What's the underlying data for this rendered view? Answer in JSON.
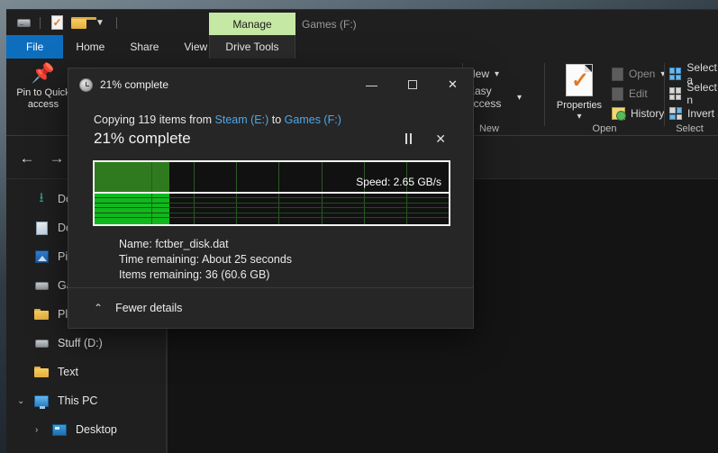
{
  "window": {
    "title": "Games (F:)",
    "contextual_tab": "Manage",
    "contextual_tab_color": "#c5e8a4"
  },
  "quick_access": {
    "items": [
      {
        "icon": "drive-icon",
        "name": "drive"
      },
      {
        "icon": "properties-icon",
        "name": "properties"
      },
      {
        "icon": "folder-icon",
        "name": "new-folder"
      },
      {
        "icon": "chevron-down-icon",
        "name": "customize"
      }
    ]
  },
  "tabs": [
    {
      "label": "File",
      "name": "tab-file",
      "active": false
    },
    {
      "label": "Home",
      "name": "tab-home",
      "active": true
    },
    {
      "label": "Share",
      "name": "tab-share",
      "active": false
    },
    {
      "label": "View",
      "name": "tab-view",
      "active": false
    },
    {
      "label": "Drive Tools",
      "name": "tab-drive-tools",
      "active": false
    }
  ],
  "ribbon": {
    "clipboard": {
      "pin_label": "Pin to Quick\naccess",
      "pin_label_line1": "Pin to Quick",
      "pin_label_line2": "access"
    },
    "groups": [
      {
        "label": "New",
        "name": "ribbon-group-new"
      },
      {
        "label": "Open",
        "name": "ribbon-group-open"
      },
      {
        "label": "Select",
        "name": "ribbon-group-select"
      }
    ],
    "new_group": {
      "new_label": "New",
      "easy_access_label": "Easy access"
    },
    "open_group": {
      "properties_label": "Properties",
      "open_label": "Open",
      "edit_label": "Edit",
      "history_label": "History"
    },
    "select_group": {
      "select_all_label": "Select a",
      "select_none_label": "Select n",
      "invert_label": "Invert s"
    }
  },
  "navigation": {
    "back": "←",
    "forward": "→"
  },
  "nav_pane": {
    "items": [
      {
        "label": "Dow",
        "icon": "downloads-icon",
        "name": "sidebar-item-downloads",
        "indent": 1,
        "chevron": ""
      },
      {
        "label": "Doc",
        "icon": "documents-icon",
        "name": "sidebar-item-documents",
        "indent": 1,
        "chevron": ""
      },
      {
        "label": "Pic",
        "icon": "pictures-icon",
        "name": "sidebar-item-pictures",
        "indent": 1,
        "chevron": ""
      },
      {
        "label": "Ga",
        "icon": "drive-icon",
        "name": "sidebar-item-games",
        "indent": 1,
        "chevron": ""
      },
      {
        "label": "Play",
        "icon": "folder-icon",
        "name": "sidebar-item-play",
        "indent": 1,
        "chevron": ""
      },
      {
        "label": "Stuff (D:)",
        "icon": "drive-icon",
        "name": "sidebar-item-stuff-d",
        "indent": 1,
        "chevron": ""
      },
      {
        "label": "Text",
        "icon": "folder-icon",
        "name": "sidebar-item-text",
        "indent": 1,
        "chevron": ""
      },
      {
        "label": "This PC",
        "icon": "this-pc-icon",
        "name": "sidebar-item-this-pc",
        "indent": 0,
        "chevron": "⌄"
      },
      {
        "label": "Desktop",
        "icon": "desktop-icon",
        "name": "sidebar-item-desktop",
        "indent": 1,
        "chevron": "›"
      }
    ]
  },
  "dialog": {
    "title": "21% complete",
    "caption": {
      "minimize": "—",
      "maximize": "maximize-box",
      "close": "✕"
    },
    "copying_prefix": "Copying 119 items from ",
    "source": "Steam (E:)",
    "copying_middle": " to ",
    "destination": "Games (F:)",
    "percent_label": "21% complete",
    "percent_value": 21,
    "controls": {
      "pause": "pause-icon",
      "cancel": "✕"
    },
    "graph": {
      "speed_label": "Speed: 2.65 GB/s",
      "fill_percent": 21,
      "top_color": "#2f7a1e",
      "bottom_color": "#10b81e"
    },
    "details": {
      "name_key": "Name:",
      "name_value": "fctber_disk.dat",
      "time_key": "Time remaining:",
      "time_value": "About 25 seconds",
      "items_key": "Items remaining:",
      "items_value": "36 (60.6 GB)"
    },
    "footer": {
      "toggle_label": "Fewer details",
      "toggle_icon": "chevron-up-icon"
    }
  }
}
